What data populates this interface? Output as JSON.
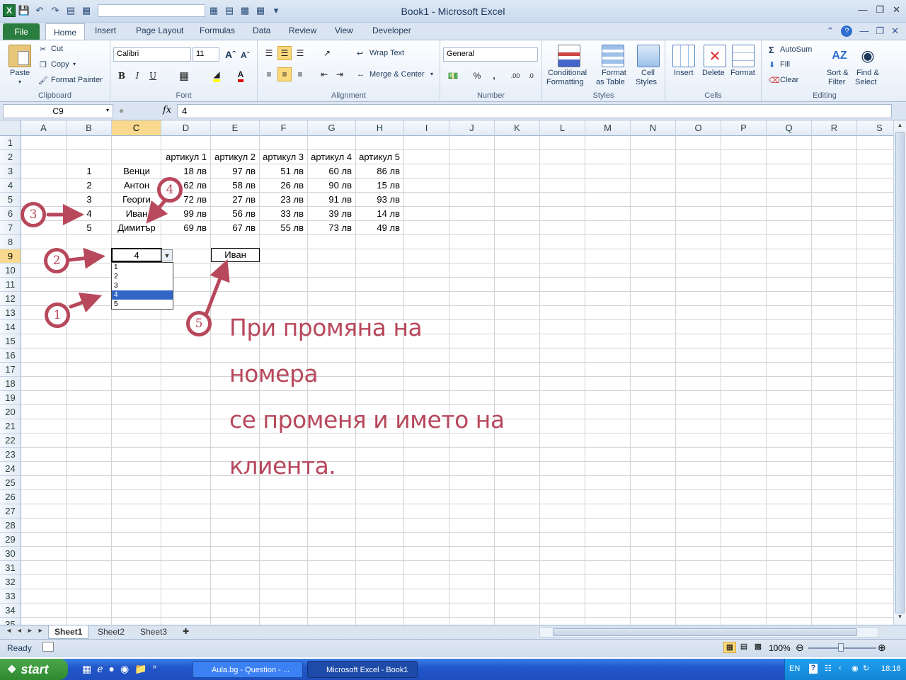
{
  "window": {
    "title": "Book1  -  Microsoft Excel"
  },
  "tabs": [
    "File",
    "Home",
    "Insert",
    "Page Layout",
    "Formulas",
    "Data",
    "Review",
    "View",
    "Developer"
  ],
  "ribbon": {
    "clipboard": {
      "paste": "Paste",
      "cut": "Cut",
      "copy": "Copy",
      "format_painter": "Format Painter",
      "label": "Clipboard"
    },
    "font": {
      "name": "Calibri",
      "size": "11",
      "label": "Font"
    },
    "alignment": {
      "wrap": "Wrap Text",
      "merge": "Merge & Center",
      "label": "Alignment"
    },
    "number": {
      "format": "General",
      "label": "Number"
    },
    "styles": {
      "cond1": "Conditional",
      "cond2": "Formatting",
      "fmt1": "Format",
      "fmt2": "as Table",
      "cell1": "Cell",
      "cell2": "Styles",
      "label": "Styles"
    },
    "cells": {
      "insert": "Insert",
      "delete": "Delete",
      "format": "Format",
      "label": "Cells"
    },
    "editing": {
      "autosum": "AutoSum",
      "fill": "Fill",
      "clear": "Clear",
      "sort1": "Sort &",
      "sort2": "Filter",
      "find1": "Find &",
      "find2": "Select",
      "label": "Editing"
    }
  },
  "formula_bar": {
    "name_box": "C9",
    "fx": "fx",
    "content": "4"
  },
  "columns": [
    "A",
    "B",
    "C",
    "D",
    "E",
    "F",
    "G",
    "H",
    "I",
    "J",
    "K",
    "L",
    "M",
    "N",
    "O",
    "P",
    "Q",
    "R",
    "S"
  ],
  "rows": [
    "1",
    "2",
    "3",
    "4",
    "5",
    "6",
    "7",
    "8",
    "9",
    "10",
    "11",
    "12",
    "13",
    "14",
    "15",
    "16",
    "17",
    "18",
    "19",
    "20",
    "21",
    "22",
    "23",
    "24",
    "25",
    "26",
    "27",
    "28",
    "29",
    "30",
    "31",
    "32",
    "33",
    "34",
    "35"
  ],
  "table": {
    "headers": [
      "артикул 1",
      "артикул 2",
      "артикул 3",
      "артикул 4",
      "артикул 5"
    ],
    "rows": [
      {
        "num": "1",
        "name": "Венци",
        "vals": [
          "18 лв",
          "97 лв",
          "51 лв",
          "60 лв",
          "86 лв"
        ]
      },
      {
        "num": "2",
        "name": "Антон",
        "vals": [
          "62 лв",
          "58 лв",
          "26 лв",
          "90 лв",
          "15 лв"
        ]
      },
      {
        "num": "3",
        "name": "Георги",
        "vals": [
          "72 лв",
          "27 лв",
          "23 лв",
          "91 лв",
          "93 лв"
        ]
      },
      {
        "num": "4",
        "name": "Иван",
        "vals": [
          "99 лв",
          "56 лв",
          "33 лв",
          "39 лв",
          "14 лв"
        ]
      },
      {
        "num": "5",
        "name": "Димитър",
        "vals": [
          "69 лв",
          "67 лв",
          "55 лв",
          "73 лв",
          "49 лв"
        ]
      }
    ]
  },
  "selected_cell_value": "4",
  "lookup_result": "Иван",
  "dropdown_options": [
    "1",
    "2",
    "3",
    "4",
    "5"
  ],
  "dropdown_selected": "4",
  "annotations": {
    "markers": [
      "1",
      "2",
      "3",
      "4",
      "5"
    ],
    "note_line1": "При промяна на номера",
    "note_line2": "се променя и името на",
    "note_line3": "клиента.",
    "color": "#b8485c"
  },
  "sheets": [
    "Sheet1",
    "Sheet2",
    "Sheet3"
  ],
  "status": {
    "ready": "Ready",
    "zoom": "100%"
  },
  "taskbar": {
    "start": "start",
    "task1": "Aula.bg - Question - ...",
    "task2": "Microsoft Excel - Book1",
    "lang": "EN",
    "clock": "18:18"
  }
}
